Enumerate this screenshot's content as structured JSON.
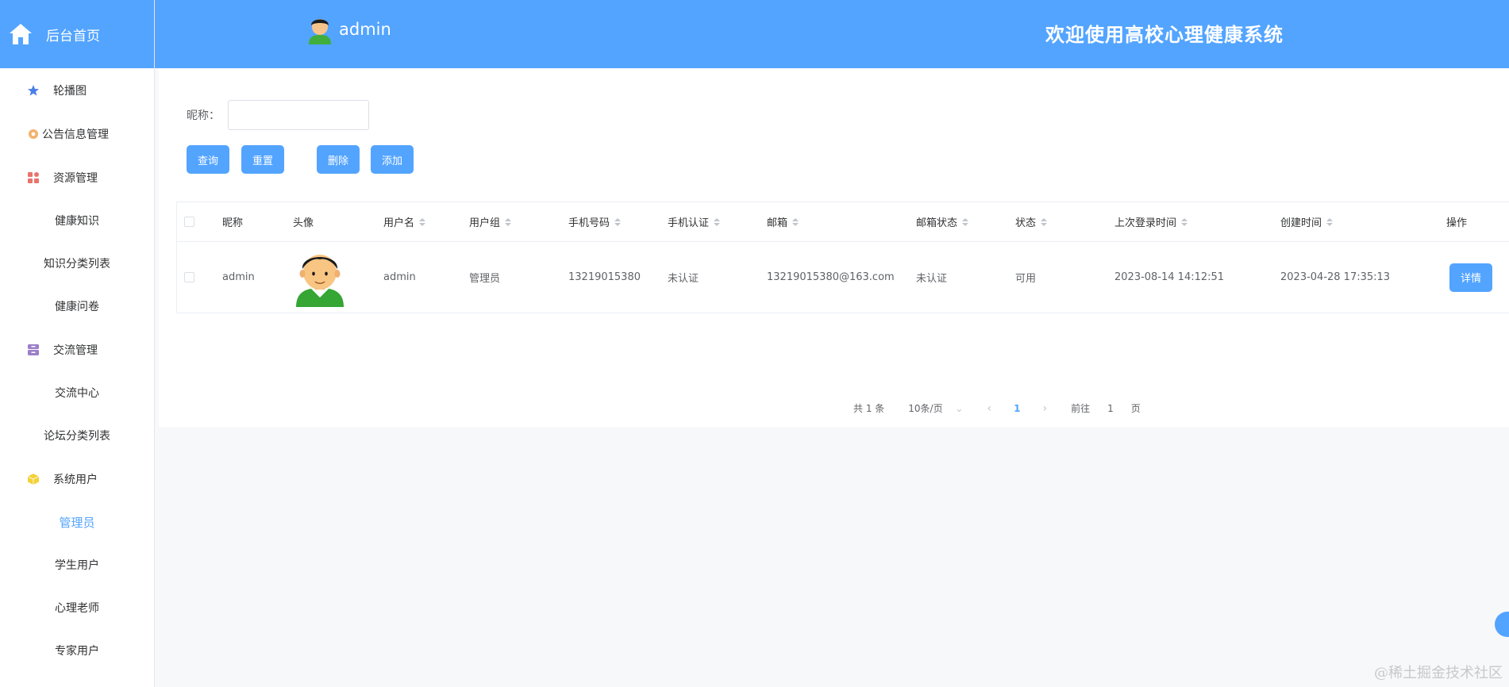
{
  "sidebar": {
    "home_label": "后台首页",
    "menu": {
      "carousel": "轮播图",
      "notice": "公告信息管理",
      "resource": "资源管理",
      "resource_sub": [
        "健康知识",
        "知识分类列表",
        "健康问卷"
      ],
      "exchange": "交流管理",
      "exchange_sub": [
        "交流中心",
        "论坛分类列表"
      ],
      "sysuser": "系统用户",
      "sysuser_sub": [
        "管理员",
        "学生用户",
        "心理老师",
        "专家用户"
      ]
    }
  },
  "header": {
    "username": "admin",
    "welcome": "欢迎使用高校心理健康系统"
  },
  "search": {
    "label": "昵称：",
    "placeholder": ""
  },
  "buttons": {
    "query": "查询",
    "reset": "重置",
    "delete": "删除",
    "add": "添加"
  },
  "table": {
    "columns": [
      "昵称",
      "头像",
      "用户名",
      "用户组",
      "手机号码",
      "手机认证",
      "邮箱",
      "邮箱状态",
      "状态",
      "上次登录时间",
      "创建时间",
      "操作"
    ],
    "rows": [
      {
        "nickname": "admin",
        "username": "admin",
        "group": "管理员",
        "phone": "13219015380",
        "phone_auth": "未认证",
        "email": "13219015380@163.com",
        "email_status": "未认证",
        "status": "可用",
        "last_login": "2023-08-14 14:12:51",
        "created": "2023-04-28 17:35:13",
        "action": "详情"
      }
    ]
  },
  "pagination": {
    "total": "共 1 条",
    "page_size": "10条/页",
    "current": "1",
    "goto_prefix": "前往",
    "goto_value": "1",
    "goto_suffix": "页"
  },
  "watermark": "@稀土掘金技术社区",
  "colors": {
    "primary": "#53a4ff",
    "header_bg": "#53a4ff"
  }
}
